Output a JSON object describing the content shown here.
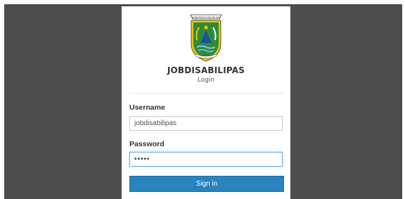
{
  "login": {
    "app_title": "JOBDISABILIPAS",
    "subtitle": "Login",
    "username_label": "Username",
    "username_value": "jobdisabilipas",
    "password_label": "Password",
    "password_value": "•••••",
    "signin_label": "Sign in"
  },
  "logo": {
    "icon": "regency-crest-icon",
    "banner_text": "KABUPATEN PASURUAN"
  },
  "colors": {
    "background": "#4d4d4d",
    "card": "#ffffff",
    "button": "#2a83be",
    "focus_border": "#66afe9",
    "crest_green": "#2e8b3a"
  }
}
